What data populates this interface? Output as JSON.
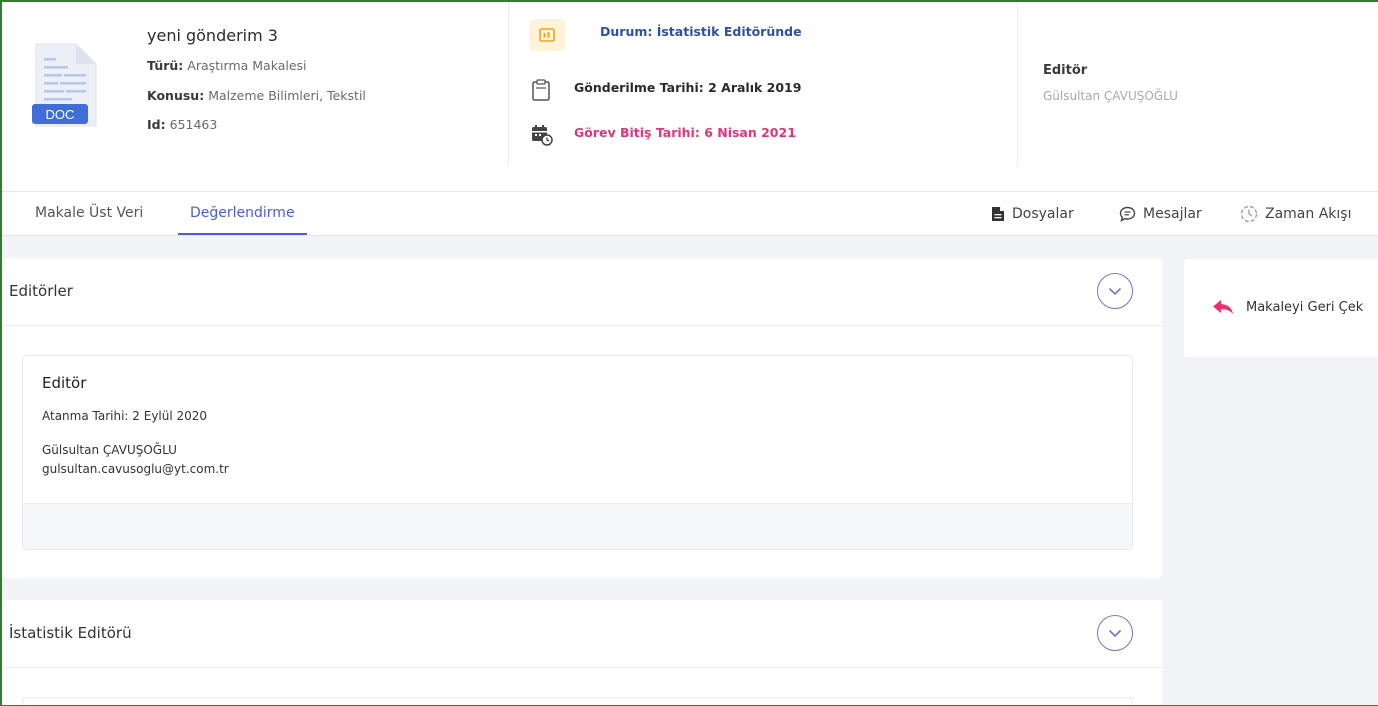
{
  "submission": {
    "title": "yeni gönderim 3",
    "type_label": "Türü:",
    "type_value": "Araştırma Makalesi",
    "subject_label": "Konusu:",
    "subject_value": "Malzeme Bilimleri, Tekstil",
    "id_label": "Id:",
    "id_value": "651463",
    "doc_badge": "DOC"
  },
  "status": {
    "status_text": "Durum: İstatistik Editöründe",
    "submitted_text": "Gönderilme Tarihi: 2 Aralık 2019",
    "deadline_text": "Görev Bitiş Tarihi: 6 Nisan 2021"
  },
  "editor_header": {
    "label": "Editör",
    "name": "Gülsultan ÇAVUŞOĞLU"
  },
  "tabs": [
    {
      "label": "Makale Üst Veri",
      "active": false
    },
    {
      "label": "Değerlendirme",
      "active": true
    }
  ],
  "actions": {
    "files": "Dosyalar",
    "messages": "Mesajlar",
    "timeline": "Zaman Akışı"
  },
  "editors_card": {
    "title": "Editörler",
    "role": "Editör",
    "assigned": "Atanma Tarihi: 2 Eylül 2020",
    "name": "Gülsultan ÇAVUŞOĞLU",
    "email": "gulsultan.cavusoglu@yt.com.tr"
  },
  "stat_editor_card": {
    "title": "İstatistik Editörü"
  },
  "side_actions": {
    "withdraw": "Makaleyi Geri Çek"
  },
  "colors": {
    "accent": "#4d5bd9",
    "status_blue": "#2f4fa8",
    "deadline_pink": "#e0357a",
    "withdraw_pink": "#e8336f",
    "chevron_purple": "#7b71c9"
  },
  "icons": {
    "doc": "doc-file-icon",
    "status": "status-board-icon",
    "submitted": "clipboard-icon",
    "deadline": "calendar-clock-icon",
    "files": "file-icon",
    "messages": "chat-icon",
    "timeline": "timeline-icon",
    "chevron": "chevron-down-icon",
    "withdraw": "reply-arrow-icon"
  }
}
